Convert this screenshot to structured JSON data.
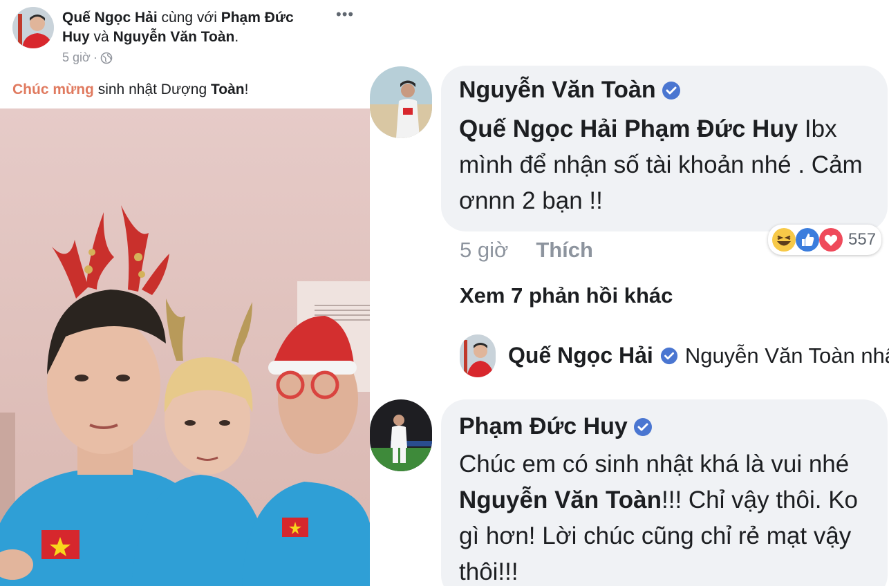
{
  "post": {
    "author": "Quế Ngọc Hải",
    "with_text": "cùng với",
    "tagged_1": "Phạm Đức",
    "tagged_1b": "Huy",
    "and_text": "và",
    "tagged_2": "Nguyễn Văn Toàn",
    "period": ".",
    "time": "5 giờ",
    "dot": "·",
    "more": "•••",
    "text_highlight": "Chúc mừng",
    "text_middle": " sinh nhật Dượng ",
    "text_bold": "Toàn",
    "text_end": "!"
  },
  "comments": [
    {
      "author": "Nguyễn Văn Toàn",
      "mention": "Quế Ngọc Hải Phạm Đức Huy",
      "text_1": "  Ibx",
      "text_2": "mình để nhận số tài khoản nhé . Cảm",
      "text_3": "ơnnn 2 bạn !!",
      "time": "5 giờ",
      "like_label": "Thích",
      "reaction_count": "557",
      "reactions": [
        "haha-icon",
        "like-icon",
        "love-icon"
      ]
    }
  ],
  "more_replies": "Xem 7 phản hồi khác",
  "reply_preview": {
    "author": "Quế Ngọc Hải",
    "text": "Nguyễn Văn Toàn nhậ..."
  },
  "comment2": {
    "author": "Phạm Đức Huy",
    "line_1": "Chúc em có sinh nhật khá là vui nhé",
    "mention": "Nguyễn Văn Toàn",
    "line_2_rest": "!!! Chỉ vậy thôi. Ko",
    "line_3": "gì hơn! Lời chúc cũng chỉ rẻ mạt vậy",
    "line_4": "thôi!!!"
  },
  "colors": {
    "highlight": "#e07a5f",
    "verified": "#4a76d1",
    "bubble": "#f0f2f5",
    "meta": "#90949c"
  }
}
